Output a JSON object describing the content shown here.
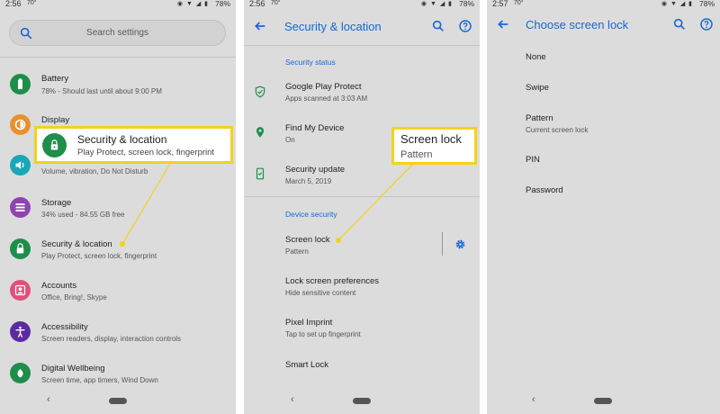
{
  "status_bars": [
    {
      "time": "2:56",
      "weather": "70°",
      "battery": "78%"
    },
    {
      "time": "2:56",
      "weather": "70°",
      "battery": "78%"
    },
    {
      "time": "2:57",
      "weather": "70°",
      "battery": "78%"
    }
  ],
  "settings": {
    "search_placeholder": "Search settings",
    "items": [
      {
        "title": "Battery",
        "subtitle": "78% - Should last until about 9:00 PM",
        "icon": "battery-icon",
        "color": "#1e8e4a"
      },
      {
        "title": "Display",
        "subtitle": "",
        "icon": "display-icon",
        "color": "#e8912d"
      },
      {
        "title": "Sound",
        "subtitle": "Volume, vibration, Do Not Disturb",
        "icon": "sound-icon",
        "color": "#1aa6b7"
      },
      {
        "title": "Storage",
        "subtitle": "34% used - 84.55 GB free",
        "icon": "storage-icon",
        "color": "#8e44ad"
      },
      {
        "title": "Security & location",
        "subtitle": "Play Protect, screen lock, fingerprint",
        "icon": "lock-icon",
        "color": "#1e8e4a"
      },
      {
        "title": "Accounts",
        "subtitle": "Office, Bring!, Skype",
        "icon": "accounts-icon",
        "color": "#e0507a"
      },
      {
        "title": "Accessibility",
        "subtitle": "Screen readers, display, interaction controls",
        "icon": "accessibility-icon",
        "color": "#5b2ca0"
      },
      {
        "title": "Digital Wellbeing",
        "subtitle": "Screen time, app timers, Wind Down",
        "icon": "wellbeing-icon",
        "color": "#1e8e4a"
      }
    ],
    "callout": {
      "title": "Security & location",
      "subtitle": "Play Protect, screen lock, fingerprint"
    }
  },
  "security": {
    "title": "Security & location",
    "section_status": "Security status",
    "status_items": [
      {
        "title": "Google Play Protect",
        "subtitle": "Apps scanned at 3:03 AM",
        "icon": "shield-check-icon"
      },
      {
        "title": "Find My Device",
        "subtitle": "On",
        "icon": "location-pin-icon"
      },
      {
        "title": "Security update",
        "subtitle": "March 5, 2019",
        "icon": "phone-update-icon"
      }
    ],
    "section_device": "Device security",
    "device_items": [
      {
        "title": "Screen lock",
        "subtitle": "Pattern"
      },
      {
        "title": "Lock screen preferences",
        "subtitle": "Hide sensitive content"
      },
      {
        "title": "Pixel Imprint",
        "subtitle": "Tap to set up fingerprint"
      },
      {
        "title": "Smart Lock",
        "subtitle": ""
      }
    ],
    "callout": {
      "title": "Screen lock",
      "subtitle": "Pattern"
    }
  },
  "screen_lock": {
    "title": "Choose screen lock",
    "options": [
      {
        "title": "None",
        "subtitle": ""
      },
      {
        "title": "Swipe",
        "subtitle": ""
      },
      {
        "title": "Pattern",
        "subtitle": "Current screen lock"
      },
      {
        "title": "PIN",
        "subtitle": ""
      },
      {
        "title": "Password",
        "subtitle": ""
      }
    ]
  },
  "colors": {
    "accent": "#1967d2",
    "callout_border": "#f2d31b",
    "panel_bg": "#dcdcdc"
  }
}
